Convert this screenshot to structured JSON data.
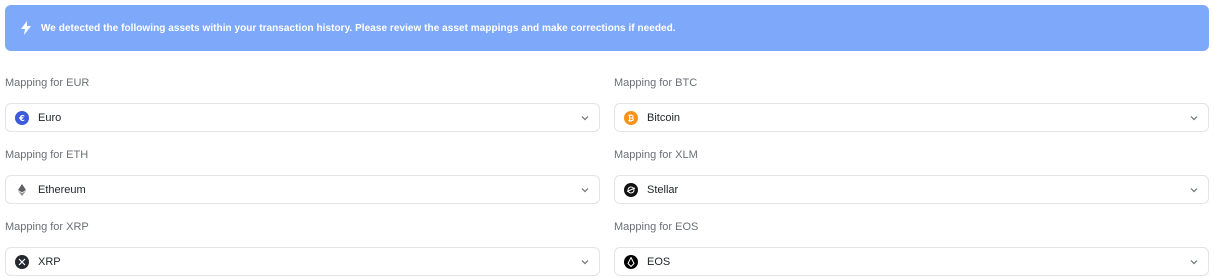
{
  "banner": {
    "icon": "lightning-icon",
    "text": "We detected the following assets within your transaction history. Please review the asset mappings and make corrections if needed."
  },
  "mappings": [
    {
      "label": "Mapping for EUR",
      "value": "Euro",
      "icon": "euro-icon",
      "icon_color": "#3b5bdb"
    },
    {
      "label": "Mapping for BTC",
      "value": "Bitcoin",
      "icon": "bitcoin-icon",
      "icon_color": "#f7931a"
    },
    {
      "label": "Mapping for ETH",
      "value": "Ethereum",
      "icon": "ethereum-icon",
      "icon_color": "#8a92b2"
    },
    {
      "label": "Mapping for XLM",
      "value": "Stellar",
      "icon": "stellar-icon",
      "icon_color": "#111111"
    },
    {
      "label": "Mapping for XRP",
      "value": "XRP",
      "icon": "xrp-icon",
      "icon_color": "#23292f"
    },
    {
      "label": "Mapping for EOS",
      "value": "EOS",
      "icon": "eos-icon",
      "icon_color": "#000000"
    }
  ]
}
